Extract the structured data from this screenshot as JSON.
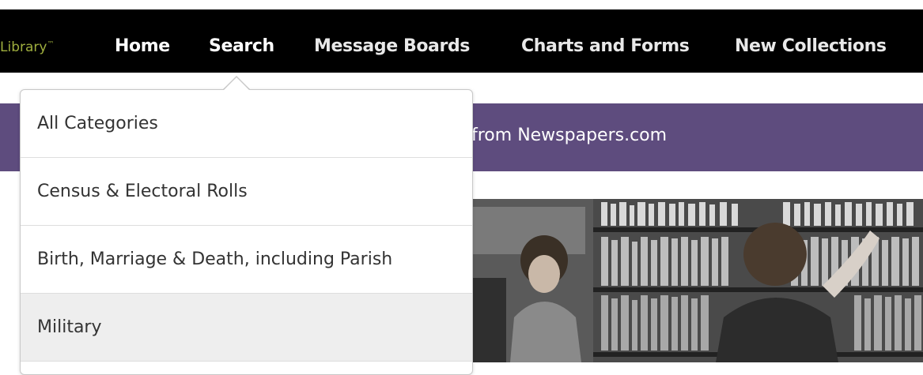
{
  "nav": {
    "logo": "Library",
    "logo_tm": "™",
    "items": [
      {
        "label": "Home"
      },
      {
        "label": "Search"
      },
      {
        "label": "Message Boards"
      },
      {
        "label": "Charts and Forms"
      },
      {
        "label": "New Collections"
      }
    ]
  },
  "banner": {
    "text": "from Newspapers.com"
  },
  "dropdown": {
    "items": [
      {
        "label": "All Categories"
      },
      {
        "label": "Census & Electoral Rolls"
      },
      {
        "label": "Birth, Marriage & Death, including Parish"
      },
      {
        "label": "Military"
      }
    ]
  },
  "colors": {
    "navbar": "#000000",
    "logo": "#9fae3e",
    "banner": "#5e4c7e",
    "hover": "#eeeeee"
  }
}
